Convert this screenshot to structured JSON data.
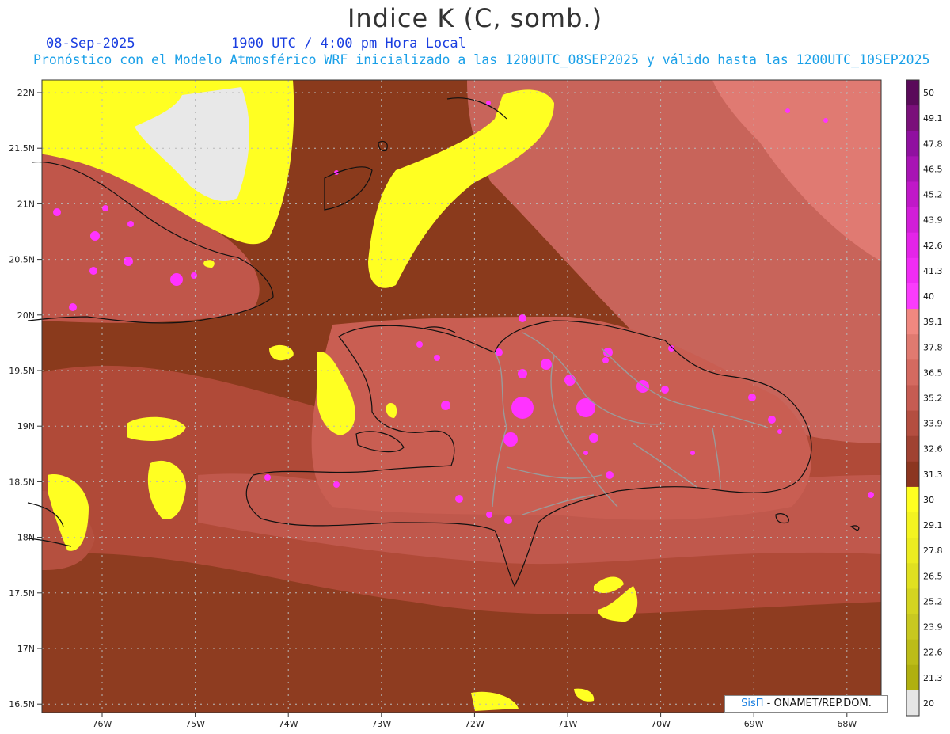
{
  "header": {
    "title": "Indice K (C, somb.)",
    "date": "08-Sep-2025",
    "time": "1900 UTC / 4:00 pm Hora Local",
    "description": "Pronóstico con el Modelo Atmosférico WRF inicializado a las 1200UTC_08SEP2025 y válido hasta las  1200UTC_10SEP2025"
  },
  "map": {
    "lat_labels": [
      "22N",
      "21.5N",
      "21N",
      "20.5N",
      "20N",
      "19.5N",
      "19N",
      "18.5N",
      "18N",
      "17.5N",
      "17N",
      "16.5N"
    ],
    "lon_labels": [
      "76W",
      "75W",
      "74W",
      "73W",
      "72W",
      "71W",
      "70W",
      "69W",
      "68W"
    ],
    "colors": {
      "dark_brown": "#8a3a1c",
      "mid_brown": "#a84a34",
      "salmon": "#c8645a",
      "pink": "#e6807a",
      "magenta": "#ff33ff",
      "yellow": "#ffff22",
      "gray": "#e8e8e8"
    }
  },
  "colorbar": {
    "labels": [
      "50",
      "49.1",
      "47.8",
      "46.5",
      "45.2",
      "43.9",
      "42.6",
      "41.3",
      "40",
      "39.1",
      "37.8",
      "36.5",
      "35.2",
      "33.9",
      "32.6",
      "31.3",
      "30",
      "29.1",
      "27.8",
      "26.5",
      "25.2",
      "23.9",
      "22.6",
      "21.3",
      "20"
    ],
    "colors": [
      "#5a0a5a",
      "#7a107a",
      "#9010a0",
      "#a814b4",
      "#c018c8",
      "#d21ed8",
      "#e424e8",
      "#f02cf4",
      "#fa3cfc",
      "#f08880",
      "#e07a70",
      "#d46a60",
      "#c65c52",
      "#b44e40",
      "#a04232",
      "#8c3620",
      "#ffff20",
      "#f4f420",
      "#ecec20",
      "#e0e020",
      "#d4d420",
      "#c8c820",
      "#bcbc18",
      "#b0b010",
      "#e6e6e6"
    ]
  },
  "credit": {
    "brand": "SisΠ",
    "text": " - ONAMET/REP.DOM."
  }
}
